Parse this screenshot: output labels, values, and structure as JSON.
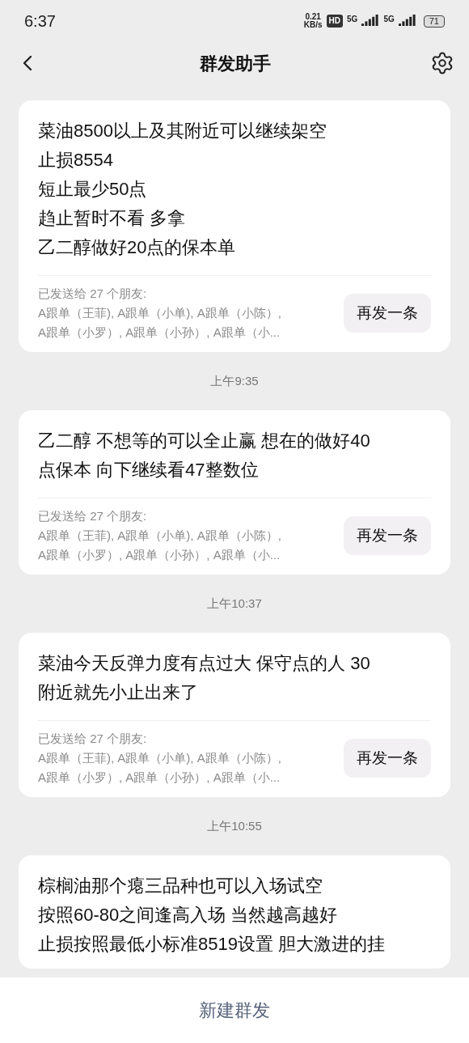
{
  "status_bar": {
    "time": "6:37",
    "speed_value": "0.21",
    "speed_unit": "KB/s",
    "hd_badge": "HD",
    "sim_1": "5G",
    "sim_2": "5G",
    "battery": "71"
  },
  "header": {
    "title": "群发助手"
  },
  "items": [
    {
      "kind": "message",
      "lines": [
        "菜油8500以上及其附近可以继续架空",
        "止损8554",
        "短止最少50点",
        "趋止暂时不看 多拿",
        "乙二醇做好20点的保本单"
      ],
      "sent_label": "已发送给 27 个朋友:",
      "recipients": [
        "A跟单（王菲), A跟单（小单), A跟单（小陈）,",
        "A跟单（小罗）, A跟单（小孙）, A跟单（小..."
      ],
      "resend": "再发一条"
    },
    {
      "kind": "time",
      "text": "上午9:35"
    },
    {
      "kind": "message",
      "lines": [
        "乙二醇 不想等的可以全止赢 想在的做好40",
        "点保本 向下继续看47整数位"
      ],
      "sent_label": "已发送给 27 个朋友:",
      "recipients": [
        "A跟单（王菲), A跟单（小单), A跟单（小陈）,",
        "A跟单（小罗）, A跟单（小孙）, A跟单（小..."
      ],
      "resend": "再发一条"
    },
    {
      "kind": "time",
      "text": "上午10:37"
    },
    {
      "kind": "message",
      "lines": [
        "菜油今天反弹力度有点过大 保守点的人 30",
        "附近就先小止出来了"
      ],
      "sent_label": "已发送给 27 个朋友:",
      "recipients": [
        "A跟单（王菲), A跟单（小单), A跟单（小陈）,",
        "A跟单（小罗）, A跟单（小孙）, A跟单（小..."
      ],
      "resend": "再发一条"
    },
    {
      "kind": "time",
      "text": "上午10:55"
    },
    {
      "kind": "message",
      "lines": [
        "棕榈油那个瘪三品种也可以入场试空",
        "按照60-80之间逢高入场 当然越高越好",
        "止损按照最低小标准8519设置 胆大激进的挂"
      ]
    }
  ],
  "bottom_button": "新建群发"
}
